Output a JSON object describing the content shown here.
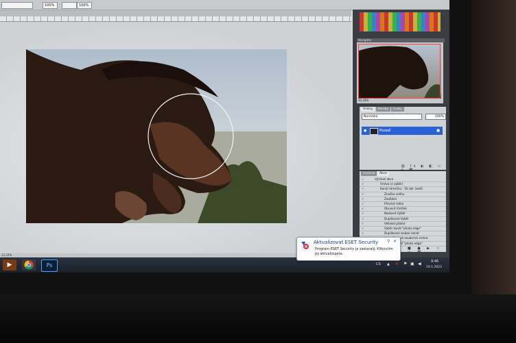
{
  "options_bar": {
    "fields": [
      "",
      "100%",
      "",
      "100%"
    ]
  },
  "canvas": {
    "status": "33,33%"
  },
  "navigator": {
    "title": "Navigátor",
    "zoom": "33,33%"
  },
  "layers": {
    "tabs": [
      "Vrstvy",
      "Kanály",
      "Cesty"
    ],
    "blend_mode": "Normální",
    "opacity": "100%",
    "layer_name": "Pozadí"
  },
  "actions": {
    "tabs": [
      "Historie",
      "Akce"
    ],
    "items": [
      "Výchozí akce",
      "Vrstva (z výběr)",
      "Kanál rámečku - 50 obr. bodů",
      "Značka sněhu",
      "Zaoblení",
      "Převést režim",
      "Obnovit Vnitřek",
      "Nastavit Výběr",
      "Duplikovat Výběr",
      "Velikost plátna",
      "Výběr kanál \"photo edge\"",
      "Duplikovat soubor kanál",
      "Vytvořit nové souborná vrstva",
      "Sloučit kanál \"photo edge\""
    ]
  },
  "taskbar": {
    "apps": [
      "media-player",
      "chrome",
      "photoshop"
    ],
    "photoshop_label": "Ps",
    "lang": "CS",
    "time": "9:46",
    "date": "19.1.2023"
  },
  "balloon": {
    "title": "Aktualizovat ESET Security",
    "body": "Program ESET Security je zastaralý. Kliknutím jej aktualizujete."
  },
  "colors": {
    "accent": "#2a62d6",
    "nav_frame": "#ff3b3b"
  }
}
